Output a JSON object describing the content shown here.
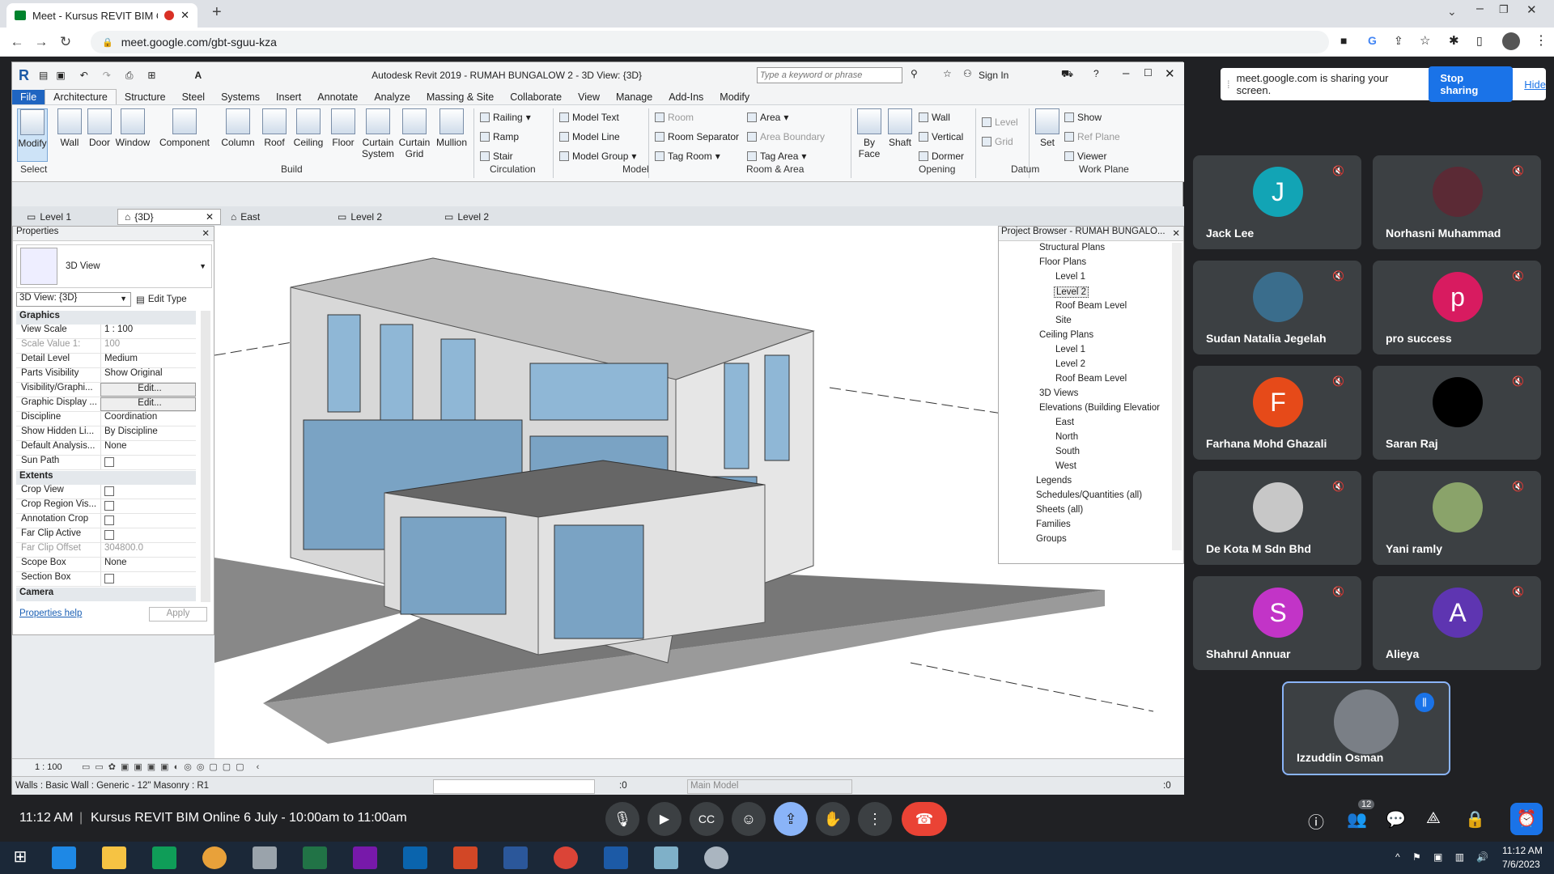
{
  "browser": {
    "tab_title": "Meet - Kursus REVIT BIM Or",
    "url": "meet.google.com/gbt-sguu-kza"
  },
  "revit": {
    "title": "Autodesk Revit 2019 - RUMAH BUNGALOW 2 - 3D View: {3D}",
    "search_placeholder": "Type a keyword or phrase",
    "sign_in": "Sign In",
    "menu_tabs": [
      "File",
      "Architecture",
      "Structure",
      "Steel",
      "Systems",
      "Insert",
      "Annotate",
      "Analyze",
      "Massing & Site",
      "Collaborate",
      "View",
      "Manage",
      "Add-Ins",
      "Modify"
    ],
    "ribbon_big": [
      "Modify",
      "Wall",
      "Door",
      "Window",
      "Component",
      "Column",
      "Roof",
      "Ceiling",
      "Floor",
      "Curtain\nSystem",
      "Curtain\nGrid",
      "Mullion",
      "By\nFace",
      "Shaft",
      "Set"
    ],
    "ribbon_small": {
      "circ": [
        "Railing",
        "Ramp",
        "Stair"
      ],
      "model": [
        "Model Text",
        "Model Line",
        "Model Group"
      ],
      "room": [
        "Room",
        "Room Separator",
        "Tag Room"
      ],
      "area": [
        "Area",
        "Area Boundary",
        "Tag Area"
      ],
      "opening": [
        "Wall",
        "Vertical",
        "Dormer"
      ],
      "datum": [
        "Level",
        "Grid"
      ],
      "work": [
        "Show",
        "Ref Plane",
        "Viewer"
      ]
    },
    "groups": [
      "Select",
      "Build",
      "Circulation",
      "Model",
      "Room & Area",
      "Opening",
      "Datum",
      "Work Plane"
    ],
    "view_tabs": [
      "Level 1",
      "{3D}",
      "East",
      "Level 2",
      "Level 2"
    ],
    "properties": {
      "title": "Properties",
      "type": "3D View",
      "selector": "3D View: {3D}",
      "edit_type": "Edit Type",
      "sections": [
        "Graphics",
        "Extents",
        "Camera"
      ],
      "graphics": [
        [
          "View Scale",
          "1 : 100"
        ],
        [
          "Scale Value    1:",
          "100"
        ],
        [
          "Detail Level",
          "Medium"
        ],
        [
          "Parts Visibility",
          "Show Original"
        ],
        [
          "Visibility/Graphi...",
          "Edit..."
        ],
        [
          "Graphic Display ...",
          "Edit..."
        ],
        [
          "Discipline",
          "Coordination"
        ],
        [
          "Show Hidden Li...",
          "By Discipline"
        ],
        [
          "Default Analysis...",
          "None"
        ],
        [
          "Sun Path",
          ""
        ]
      ],
      "extents": [
        [
          "Crop View",
          ""
        ],
        [
          "Crop Region Vis...",
          ""
        ],
        [
          "Annotation Crop",
          ""
        ],
        [
          "Far Clip Active",
          ""
        ],
        [
          "Far Clip Offset",
          "304800.0"
        ],
        [
          "Scope Box",
          "None"
        ],
        [
          "Section Box",
          ""
        ]
      ],
      "help": "Properties help",
      "apply": "Apply"
    },
    "browser": {
      "title": "Project Browser - RUMAH BUNGALO...",
      "items": [
        "Structural Plans",
        "Floor Plans",
        "Level 1",
        "Level 2",
        "Roof Beam Level",
        "Site",
        "Ceiling Plans",
        "Level 1",
        "Level 2",
        "Roof Beam Level",
        "3D Views",
        "Elevations (Building Elevatior",
        "East",
        "North",
        "South",
        "West",
        "Legends",
        "Schedules/Quantities (all)",
        "Sheets (all)",
        "Families",
        "Groups"
      ]
    },
    "scale": "1 : 100",
    "status_text": "Walls : Basic Wall : Generic - 12\" Masonry : R1",
    "zero": ":0",
    "workset": "Main Model",
    "filter": ":0"
  },
  "meet": {
    "sharing_text": "meet.google.com is sharing your screen.",
    "stop_sharing": "Stop sharing",
    "hide": "Hide",
    "participants": [
      {
        "name": "Jack Lee",
        "initial": "J",
        "color": "#12a4b5"
      },
      {
        "name": "Norhasni Muhammad",
        "initial": "",
        "color": "#5b2a35"
      },
      {
        "name": "Sudan Natalia Jegelah",
        "initial": "",
        "color": "#3a6d8c"
      },
      {
        "name": "pro success",
        "initial": "p",
        "color": "#d81b60"
      },
      {
        "name": "Farhana Mohd Ghazali",
        "initial": "F",
        "color": "#e64a19"
      },
      {
        "name": "Saran Raj",
        "initial": "",
        "color": "#000000"
      },
      {
        "name": "De Kota M Sdn Bhd",
        "initial": "",
        "color": "#c7c7c7"
      },
      {
        "name": "Yani ramly",
        "initial": "",
        "color": "#8aa36a"
      },
      {
        "name": "Shahrul Annuar",
        "initial": "S",
        "color": "#c234c7"
      },
      {
        "name": "Alieya",
        "initial": "A",
        "color": "#5e35b1"
      },
      {
        "name": "Izzuddin Osman",
        "initial": "",
        "color": "#7a7f86"
      }
    ],
    "time": "11:12 AM",
    "meeting_title": "Kursus REVIT BIM Online 6 July - 10:00am to 11:00am",
    "people_count": "12"
  },
  "taskbar": {
    "time": "11:12 AM",
    "date": "7/6/2023"
  }
}
